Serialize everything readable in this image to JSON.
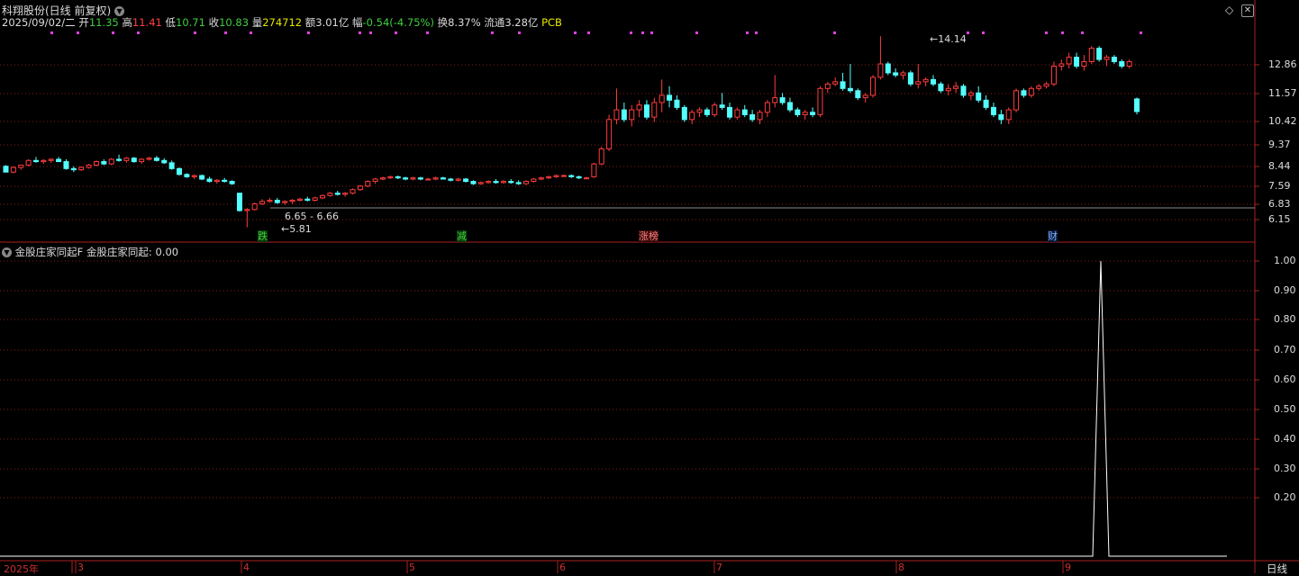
{
  "header": {
    "title": "科翔股份(日线 前复权)",
    "date": "2025/09/02/二",
    "open_label": "开",
    "open": "11.35",
    "high_label": "高",
    "high": "11.41",
    "low_label": "低",
    "low": "10.71",
    "close_label": "收",
    "close": "10.83",
    "vol_label": "量",
    "vol": "274712",
    "amt_label": "额",
    "amt": "3.01亿",
    "chg_label": "幅",
    "chg": "-0.54(-4.75%)",
    "turn_label": "换",
    "turn": "8.37%",
    "float_label": "流通",
    "float": "3.28亿",
    "sector": "PCB"
  },
  "indicator": {
    "name": "金股庄家同起F",
    "value_label": "金股庄家同起:",
    "value": "0.00"
  },
  "price_axis": [
    "12.86",
    "11.57",
    "10.42",
    "9.37",
    "8.44",
    "7.59",
    "6.83",
    "6.15"
  ],
  "indicator_axis": [
    "1.00",
    "0.90",
    "0.80",
    "0.70",
    "0.60",
    "0.50",
    "0.40",
    "0.30",
    "0.20"
  ],
  "annotations": {
    "high_point": "14.14",
    "low_point": "5.81",
    "gap_range": "6.65 - 6.66"
  },
  "event_markers": [
    {
      "label": "跌",
      "color": "#3fcf3f"
    },
    {
      "label": "减",
      "color": "#3fcf3f"
    },
    {
      "label": "涨榜",
      "color": "#ff5050"
    },
    {
      "label": "财",
      "color": "#7fb0ff"
    }
  ],
  "time_axis": [
    "2025年",
    "3",
    "4",
    "5",
    "6",
    "7",
    "8",
    "9"
  ],
  "period_label": "日线",
  "colors": {
    "up": "#ff3c3c",
    "down": "#54ffff",
    "grid": "#8b1a1a",
    "line": "#ffffff",
    "magenta": "#e040e0"
  },
  "chart_data": {
    "type": "candlestick",
    "price_ticks": [
      12.86,
      11.57,
      10.42,
      9.37,
      8.44,
      7.59,
      6.83,
      6.15
    ],
    "indicator_ticks": [
      1.0,
      0.9,
      0.8,
      0.7,
      0.6,
      0.5,
      0.4,
      0.3,
      0.2
    ],
    "indicator_spike_value": 1.0,
    "candles_ohlc": [
      [
        8.45,
        8.5,
        8.2,
        8.2
      ],
      [
        8.2,
        8.45,
        8.15,
        8.4
      ],
      [
        8.4,
        8.5,
        8.3,
        8.5
      ],
      [
        8.5,
        8.75,
        8.45,
        8.7
      ],
      [
        8.7,
        8.85,
        8.6,
        8.65
      ],
      [
        8.65,
        8.75,
        8.55,
        8.7
      ],
      [
        8.7,
        8.8,
        8.6,
        8.75
      ],
      [
        8.75,
        8.85,
        8.65,
        8.65
      ],
      [
        8.65,
        8.75,
        8.3,
        8.35
      ],
      [
        8.35,
        8.45,
        8.2,
        8.3
      ],
      [
        8.3,
        8.45,
        8.25,
        8.4
      ],
      [
        8.4,
        8.55,
        8.35,
        8.5
      ],
      [
        8.5,
        8.7,
        8.45,
        8.65
      ],
      [
        8.65,
        8.75,
        8.5,
        8.55
      ],
      [
        8.55,
        8.8,
        8.5,
        8.75
      ],
      [
        8.75,
        8.95,
        8.65,
        8.7
      ],
      [
        8.7,
        8.85,
        8.6,
        8.8
      ],
      [
        8.8,
        8.85,
        8.6,
        8.65
      ],
      [
        8.65,
        8.8,
        8.55,
        8.75
      ],
      [
        8.75,
        8.85,
        8.7,
        8.8
      ],
      [
        8.8,
        8.9,
        8.65,
        8.7
      ],
      [
        8.7,
        8.8,
        8.55,
        8.6
      ],
      [
        8.6,
        8.7,
        8.3,
        8.35
      ],
      [
        8.35,
        8.4,
        8.05,
        8.1
      ],
      [
        8.1,
        8.15,
        7.95,
        8.0
      ],
      [
        8.0,
        8.1,
        7.9,
        8.05
      ],
      [
        8.05,
        8.1,
        7.85,
        7.9
      ],
      [
        7.9,
        8.0,
        7.75,
        7.8
      ],
      [
        7.8,
        7.9,
        7.7,
        7.85
      ],
      [
        7.85,
        7.95,
        7.75,
        7.8
      ],
      [
        7.8,
        7.85,
        7.65,
        7.7
      ],
      [
        7.3,
        7.3,
        6.5,
        6.55
      ],
      [
        6.55,
        6.66,
        5.81,
        6.6
      ],
      [
        6.6,
        6.9,
        6.55,
        6.85
      ],
      [
        6.85,
        7.05,
        6.8,
        6.95
      ],
      [
        6.95,
        7.1,
        6.9,
        7.0
      ],
      [
        7.0,
        7.1,
        6.85,
        6.9
      ],
      [
        6.9,
        7.0,
        6.8,
        6.95
      ],
      [
        6.95,
        7.05,
        6.85,
        7.0
      ],
      [
        7.0,
        7.1,
        6.95,
        7.05
      ],
      [
        7.05,
        7.15,
        6.95,
        7.0
      ],
      [
        7.0,
        7.15,
        6.95,
        7.1
      ],
      [
        7.1,
        7.25,
        7.05,
        7.2
      ],
      [
        7.2,
        7.35,
        7.15,
        7.3
      ],
      [
        7.3,
        7.4,
        7.2,
        7.25
      ],
      [
        7.25,
        7.35,
        7.15,
        7.3
      ],
      [
        7.3,
        7.5,
        7.25,
        7.45
      ],
      [
        7.45,
        7.65,
        7.4,
        7.6
      ],
      [
        7.6,
        7.85,
        7.55,
        7.8
      ],
      [
        7.8,
        7.95,
        7.7,
        7.9
      ],
      [
        7.9,
        8.0,
        7.85,
        7.95
      ],
      [
        7.95,
        8.05,
        7.9,
        8.0
      ],
      [
        8.0,
        8.05,
        7.9,
        7.95
      ],
      [
        7.95,
        8.0,
        7.85,
        7.9
      ],
      [
        7.9,
        8.0,
        7.85,
        7.95
      ],
      [
        7.95,
        8.0,
        7.85,
        7.9
      ],
      [
        7.9,
        7.95,
        7.85,
        7.9
      ],
      [
        7.9,
        8.0,
        7.85,
        7.95
      ],
      [
        7.95,
        8.0,
        7.9,
        7.9
      ],
      [
        7.9,
        7.95,
        7.8,
        7.85
      ],
      [
        7.85,
        7.95,
        7.8,
        7.9
      ],
      [
        7.9,
        7.95,
        7.75,
        7.8
      ],
      [
        7.8,
        7.85,
        7.65,
        7.7
      ],
      [
        7.7,
        7.8,
        7.65,
        7.75
      ],
      [
        7.75,
        7.85,
        7.7,
        7.8
      ],
      [
        7.8,
        7.9,
        7.7,
        7.75
      ],
      [
        7.75,
        7.85,
        7.7,
        7.8
      ],
      [
        7.8,
        7.9,
        7.7,
        7.75
      ],
      [
        7.75,
        7.85,
        7.65,
        7.7
      ],
      [
        7.7,
        7.85,
        7.65,
        7.8
      ],
      [
        7.8,
        7.95,
        7.75,
        7.9
      ],
      [
        7.9,
        8.0,
        7.85,
        7.95
      ],
      [
        7.95,
        8.05,
        7.9,
        8.0
      ],
      [
        8.0,
        8.1,
        7.95,
        8.05
      ],
      [
        8.05,
        8.1,
        8.0,
        8.05
      ],
      [
        8.05,
        8.1,
        7.95,
        8.0
      ],
      [
        8.0,
        8.05,
        7.9,
        7.95
      ],
      [
        7.95,
        8.0,
        7.9,
        7.95
      ],
      [
        8.0,
        8.6,
        7.95,
        8.55
      ],
      [
        8.55,
        9.3,
        8.5,
        9.2
      ],
      [
        9.2,
        10.7,
        9.1,
        10.5
      ],
      [
        10.5,
        11.8,
        10.3,
        10.9
      ],
      [
        10.9,
        11.2,
        10.4,
        10.5
      ],
      [
        10.5,
        11.1,
        10.2,
        10.9
      ],
      [
        10.9,
        11.3,
        10.6,
        11.1
      ],
      [
        11.1,
        11.3,
        10.5,
        10.6
      ],
      [
        10.6,
        11.4,
        10.4,
        11.2
      ],
      [
        11.2,
        12.2,
        10.8,
        11.5
      ],
      [
        11.5,
        11.9,
        11.0,
        11.3
      ],
      [
        11.3,
        11.5,
        10.9,
        11.0
      ],
      [
        11.0,
        11.1,
        10.4,
        10.5
      ],
      [
        10.5,
        10.9,
        10.3,
        10.8
      ],
      [
        10.8,
        11.0,
        10.6,
        10.9
      ],
      [
        10.9,
        11.0,
        10.6,
        10.7
      ],
      [
        10.7,
        11.2,
        10.6,
        11.1
      ],
      [
        11.1,
        11.6,
        10.9,
        11.0
      ],
      [
        11.0,
        11.2,
        10.5,
        10.6
      ],
      [
        10.6,
        11.0,
        10.5,
        10.9
      ],
      [
        10.9,
        11.1,
        10.6,
        10.7
      ],
      [
        10.7,
        10.9,
        10.4,
        10.5
      ],
      [
        10.5,
        10.9,
        10.3,
        10.8
      ],
      [
        10.8,
        11.3,
        10.6,
        11.2
      ],
      [
        11.2,
        12.4,
        11.0,
        11.4
      ],
      [
        11.4,
        11.6,
        11.1,
        11.2
      ],
      [
        11.2,
        11.4,
        10.8,
        10.9
      ],
      [
        10.9,
        11.0,
        10.6,
        10.7
      ],
      [
        10.7,
        10.9,
        10.5,
        10.8
      ],
      [
        10.8,
        11.0,
        10.6,
        10.7
      ],
      [
        10.7,
        11.9,
        10.6,
        11.8
      ],
      [
        11.8,
        12.1,
        11.6,
        12.0
      ],
      [
        12.0,
        12.3,
        11.9,
        12.1
      ],
      [
        12.1,
        12.5,
        11.7,
        11.8
      ],
      [
        11.8,
        12.9,
        11.6,
        11.7
      ],
      [
        11.7,
        11.8,
        11.3,
        11.4
      ],
      [
        11.4,
        11.6,
        11.2,
        11.5
      ],
      [
        11.5,
        12.4,
        11.4,
        12.3
      ],
      [
        12.3,
        14.14,
        12.2,
        12.9
      ],
      [
        12.9,
        13.0,
        12.4,
        12.5
      ],
      [
        12.5,
        12.7,
        12.3,
        12.4
      ],
      [
        12.4,
        12.6,
        12.2,
        12.5
      ],
      [
        12.5,
        12.6,
        11.9,
        12.0
      ],
      [
        12.0,
        12.9,
        11.8,
        12.1
      ],
      [
        12.1,
        12.3,
        11.9,
        12.2
      ],
      [
        12.2,
        12.4,
        11.9,
        12.0
      ],
      [
        12.0,
        12.1,
        11.6,
        11.7
      ],
      [
        11.7,
        12.0,
        11.5,
        11.8
      ],
      [
        11.8,
        12.1,
        11.6,
        11.9
      ],
      [
        11.9,
        12.0,
        11.4,
        11.5
      ],
      [
        11.5,
        11.7,
        11.3,
        11.6
      ],
      [
        11.6,
        11.9,
        11.2,
        11.3
      ],
      [
        11.3,
        11.5,
        10.9,
        11.0
      ],
      [
        11.0,
        11.2,
        10.6,
        10.7
      ],
      [
        10.7,
        10.9,
        10.3,
        10.5
      ],
      [
        10.5,
        11.0,
        10.3,
        10.9
      ],
      [
        10.9,
        11.8,
        10.8,
        11.7
      ],
      [
        11.7,
        11.8,
        11.4,
        11.5
      ],
      [
        11.5,
        11.9,
        11.4,
        11.8
      ],
      [
        11.8,
        12.0,
        11.7,
        11.9
      ],
      [
        11.9,
        12.1,
        11.8,
        12.0
      ],
      [
        12.0,
        13.0,
        11.9,
        12.8
      ],
      [
        12.8,
        13.1,
        12.6,
        12.9
      ],
      [
        12.9,
        13.4,
        12.7,
        13.2
      ],
      [
        13.2,
        13.4,
        12.7,
        12.8
      ],
      [
        12.8,
        13.3,
        12.6,
        13.0
      ],
      [
        13.0,
        13.7,
        12.9,
        13.6
      ],
      [
        13.6,
        13.7,
        13.0,
        13.1
      ],
      [
        13.1,
        13.3,
        12.8,
        13.2
      ],
      [
        13.2,
        13.3,
        12.9,
        13.0
      ],
      [
        13.0,
        13.1,
        12.7,
        12.8
      ],
      [
        12.8,
        13.1,
        12.7,
        13.0
      ],
      [
        11.35,
        11.41,
        10.71,
        10.83
      ]
    ]
  }
}
